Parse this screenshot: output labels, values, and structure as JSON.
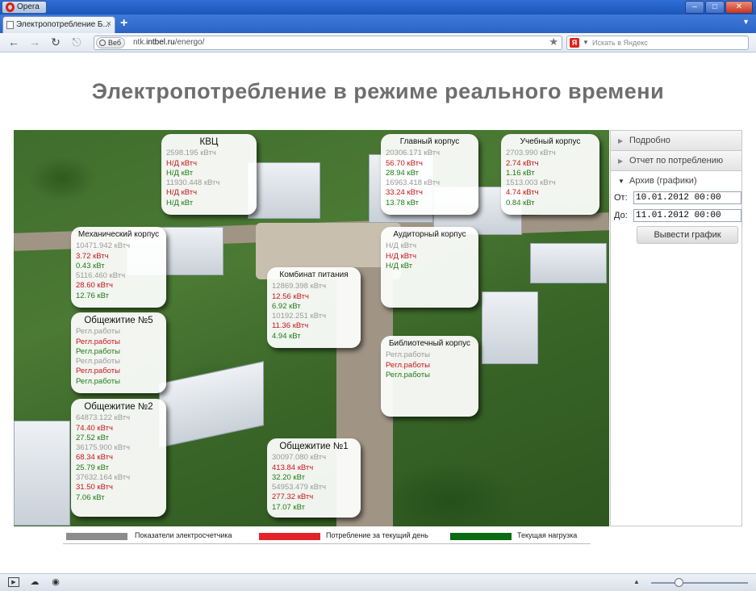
{
  "browser": {
    "app_name": "Opera",
    "tab_title": "Электропотребление Б...",
    "new_tab_label": "+",
    "web_badge": "Веб",
    "url_prefix": "ntk.",
    "url_host": "intbel.ru",
    "url_path": "/energo/",
    "search_placeholder": "Искать в Яндекс",
    "search_engine_logo": "Я"
  },
  "page": {
    "title": "Электропотребление в режиме реального времени"
  },
  "buildings": [
    {
      "name": "КВЦ",
      "lines": [
        {
          "kind": "meter",
          "text": "2598.195 кВтч"
        },
        {
          "kind": "day",
          "text": "Н/Д кВтч"
        },
        {
          "kind": "load",
          "text": "Н/Д кВт"
        },
        {
          "kind": "meter",
          "text": "11930.448 кВтч"
        },
        {
          "kind": "day",
          "text": "Н/Д кВтч"
        },
        {
          "kind": "load",
          "text": "Н/Д кВт"
        }
      ]
    },
    {
      "name": "Главный корпус",
      "lines": [
        {
          "kind": "meter",
          "text": "20306.171 кВтч"
        },
        {
          "kind": "day",
          "text": "56.70 кВтч"
        },
        {
          "kind": "load",
          "text": "28.94 кВт"
        },
        {
          "kind": "meter",
          "text": "16963.418 кВтч"
        },
        {
          "kind": "day",
          "text": "33.24 кВтч"
        },
        {
          "kind": "load",
          "text": "13.78 кВт"
        }
      ]
    },
    {
      "name": "Учебный корпус",
      "lines": [
        {
          "kind": "meter",
          "text": "2703.990 кВтч"
        },
        {
          "kind": "day",
          "text": "2.74 кВтч"
        },
        {
          "kind": "load",
          "text": "1.16 кВт"
        },
        {
          "kind": "meter",
          "text": "1513.003 кВтч"
        },
        {
          "kind": "day",
          "text": "4.74 кВтч"
        },
        {
          "kind": "load",
          "text": "0.84 кВт"
        }
      ]
    },
    {
      "name": "Механический корпус",
      "lines": [
        {
          "kind": "meter",
          "text": "10471.942 кВтч"
        },
        {
          "kind": "day",
          "text": "3.72 кВтч"
        },
        {
          "kind": "load",
          "text": "0.43 кВт"
        },
        {
          "kind": "meter",
          "text": "5116.460 кВтч"
        },
        {
          "kind": "day",
          "text": "28.60 кВтч"
        },
        {
          "kind": "load",
          "text": "12.76 кВт"
        }
      ]
    },
    {
      "name": "Аудиторный корпус",
      "lines": [
        {
          "kind": "meter",
          "text": "Н/Д кВтч"
        },
        {
          "kind": "day",
          "text": "Н/Д кВтч"
        },
        {
          "kind": "load",
          "text": "Н/Д кВт"
        }
      ]
    },
    {
      "name": "Комбинат питания",
      "lines": [
        {
          "kind": "meter",
          "text": "12869.398 кВтч"
        },
        {
          "kind": "day",
          "text": "12.56 кВтч"
        },
        {
          "kind": "load",
          "text": "6.92 кВт"
        },
        {
          "kind": "meter",
          "text": "10192.251 кВтч"
        },
        {
          "kind": "day",
          "text": "11.36 кВтч"
        },
        {
          "kind": "load",
          "text": "4.94 кВт"
        }
      ]
    },
    {
      "name": "Общежитие №5",
      "lines": [
        {
          "kind": "meter",
          "text": "Регл.работы"
        },
        {
          "kind": "day",
          "text": "Регл.работы"
        },
        {
          "kind": "load",
          "text": "Регл.работы"
        },
        {
          "kind": "meter",
          "text": "Регл.работы"
        },
        {
          "kind": "day",
          "text": "Регл.работы"
        },
        {
          "kind": "load",
          "text": "Регл.работы"
        }
      ]
    },
    {
      "name": "Библиотечный корпус",
      "lines": [
        {
          "kind": "meter",
          "text": "Регл.работы"
        },
        {
          "kind": "day",
          "text": "Регл.работы"
        },
        {
          "kind": "load",
          "text": "Регл.работы"
        }
      ]
    },
    {
      "name": "Общежитие №2",
      "lines": [
        {
          "kind": "meter",
          "text": "64873.122 кВтч"
        },
        {
          "kind": "day",
          "text": "74.40 кВтч"
        },
        {
          "kind": "load",
          "text": "27.52 кВт"
        },
        {
          "kind": "meter",
          "text": "36175.900 кВтч"
        },
        {
          "kind": "day",
          "text": "68.34 кВтч"
        },
        {
          "kind": "load",
          "text": "25.79 кВт"
        },
        {
          "kind": "meter",
          "text": "37632.164 кВтч"
        },
        {
          "kind": "day",
          "text": "31.50 кВтч"
        },
        {
          "kind": "load",
          "text": "7.06 кВт"
        }
      ]
    },
    {
      "name": "Общежитие №1",
      "lines": [
        {
          "kind": "meter",
          "text": "30097.080 кВтч"
        },
        {
          "kind": "day",
          "text": "413.84 кВтч"
        },
        {
          "kind": "load",
          "text": "32.20 кВт"
        },
        {
          "kind": "meter",
          "text": "54953.479 кВтч"
        },
        {
          "kind": "day",
          "text": "277.32 кВтч"
        },
        {
          "kind": "load",
          "text": "17.07 кВт"
        }
      ]
    }
  ],
  "panel": {
    "details_label": "Подробно",
    "report_label": "Отчет по потреблению",
    "archive_label": "Архив (графики)",
    "from_label": "От:",
    "from_value": "10.01.2012 00:00",
    "to_label": "До:",
    "to_value": "11.01.2012 00:00",
    "export_button": "Вывести график"
  },
  "legend": [
    {
      "label": "Показатели электросчетчика",
      "color": "#8c8c8c"
    },
    {
      "label": "Потребление за текущий день",
      "color": "#e2242a"
    },
    {
      "label": "Текущая нагрузка",
      "color": "#0b6a12"
    }
  ],
  "colors": {
    "meter_text": "#9a9a9a",
    "day_text": "#c8141a",
    "load_text": "#1f7a14"
  },
  "icons": {
    "back": "arrow-left",
    "forward": "arrow-right",
    "reload": "reload",
    "key": "key",
    "bookmark": "star",
    "status_panel": "panel-toggle",
    "status_cloud": "cloud",
    "status_speed": "speed-dial"
  }
}
